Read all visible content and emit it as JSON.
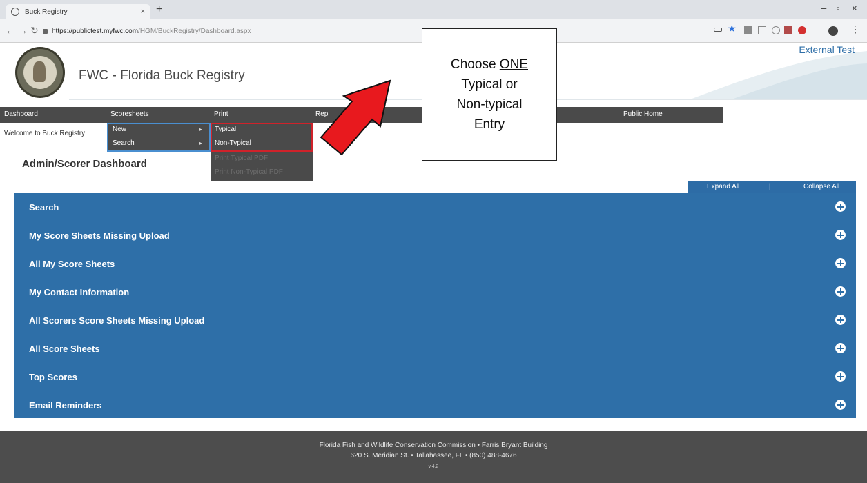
{
  "browser": {
    "tab_title": "Buck Registry",
    "tab_close": "×",
    "new_tab": "+",
    "url_host": "https://publictest.myfwc.com",
    "url_path": "/HGM/BuckRegistry/Dashboard.aspx",
    "window_minimize": "–",
    "window_maximize": "▫",
    "window_close": "×"
  },
  "header": {
    "environment": "External Test",
    "brand": "FWC - Florida Buck Registry"
  },
  "nav": {
    "items": [
      "Dashboard",
      "Scoresheets",
      "Print",
      "Rep",
      "Public Home"
    ]
  },
  "welcome": "Welcome to Buck Registry",
  "menu_scoresheets": {
    "items": [
      "New",
      "Search"
    ]
  },
  "menu_new": {
    "items": [
      "Typical",
      "Non-Typical",
      "Print Typical PDF",
      "Print Non-Typical PDF"
    ]
  },
  "page_title": "Admin/Scorer Dashboard",
  "controls": {
    "expand_all": "Expand All",
    "separator": "|",
    "collapse_all": "Collapse All"
  },
  "accordion": [
    "Search",
    "My Score Sheets Missing Upload",
    "All My Score Sheets",
    "My Contact Information",
    "All Scorers Score Sheets Missing Upload",
    "All Score Sheets",
    "Top Scores",
    "Email Reminders"
  ],
  "callout": {
    "line1_prefix": "Choose ",
    "line1_emphasis": "ONE",
    "line2": "Typical or",
    "line3": "Non-typical",
    "line4": "Entry"
  },
  "footer": {
    "line1": "Florida Fish and Wildlife Conservation Commission • Farris Bryant Building",
    "line2": "620 S. Meridian St. • Tallahassee, FL • (850) 488-4676",
    "version": "v.4.2"
  },
  "colors": {
    "nav_bg": "#4a4a4a",
    "accordion_bg": "#2e6fa8",
    "highlight_red": "#d0222a",
    "footer_bg": "#4d4d4d"
  }
}
